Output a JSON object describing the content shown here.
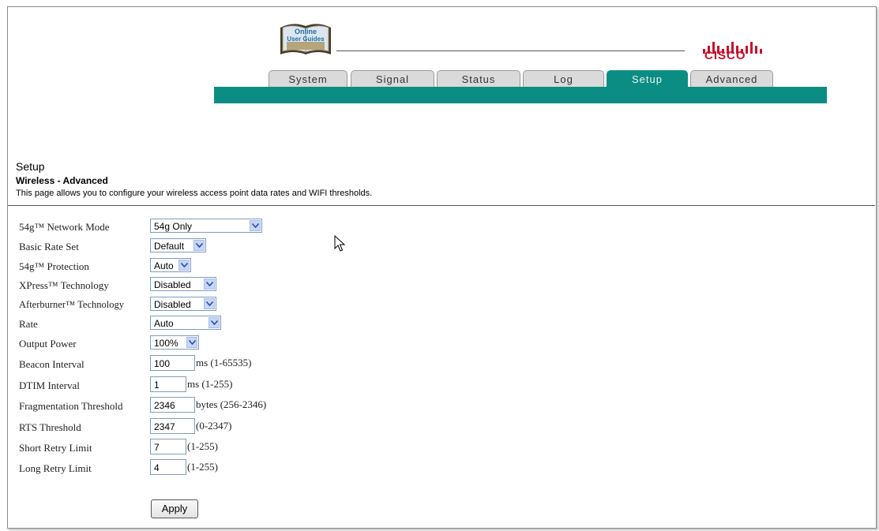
{
  "header": {
    "logo_line1": "Online",
    "logo_line2": "User Guides",
    "brand": "CISCO"
  },
  "tabs": [
    {
      "label": "System",
      "active": false
    },
    {
      "label": "Signal",
      "active": false
    },
    {
      "label": "Status",
      "active": false
    },
    {
      "label": "Log",
      "active": false
    },
    {
      "label": "Setup",
      "active": true
    },
    {
      "label": "Advanced",
      "active": false
    }
  ],
  "page": {
    "title": "Setup",
    "subtitle": "Wireless - Advanced",
    "description": "This page allows you to configure your wireless access point data rates and WIFI thresholds."
  },
  "form": {
    "network_mode": {
      "label": "54g™ Network Mode",
      "value": "54g Only"
    },
    "basic_rate_set": {
      "label": "Basic Rate Set",
      "value": "Default"
    },
    "protection": {
      "label": "54g™ Protection",
      "value": "Auto"
    },
    "xpress": {
      "label": "XPress™ Technology",
      "value": "Disabled"
    },
    "afterburner": {
      "label": "Afterburner™ Technology",
      "value": "Disabled"
    },
    "rate": {
      "label": "Rate",
      "value": "Auto"
    },
    "output_power": {
      "label": "Output Power",
      "value": "100%"
    },
    "beacon_interval": {
      "label": "Beacon Interval",
      "value": "100",
      "unit": "ms (1-65535)"
    },
    "dtim_interval": {
      "label": "DTIM Interval",
      "value": "1",
      "unit": "ms (1-255)"
    },
    "fragmentation_threshold": {
      "label": "Fragmentation Threshold",
      "value": "2346",
      "unit": "bytes (256-2346)"
    },
    "rts_threshold": {
      "label": "RTS Threshold",
      "value": "2347",
      "unit": "(0-2347)"
    },
    "short_retry_limit": {
      "label": "Short Retry Limit",
      "value": "7",
      "unit": "(1-255)"
    },
    "long_retry_limit": {
      "label": "Long Retry Limit",
      "value": "4",
      "unit": "(1-255)"
    },
    "apply_label": "Apply"
  },
  "colors": {
    "accent": "#0c8d83",
    "brand": "#c8102e"
  }
}
